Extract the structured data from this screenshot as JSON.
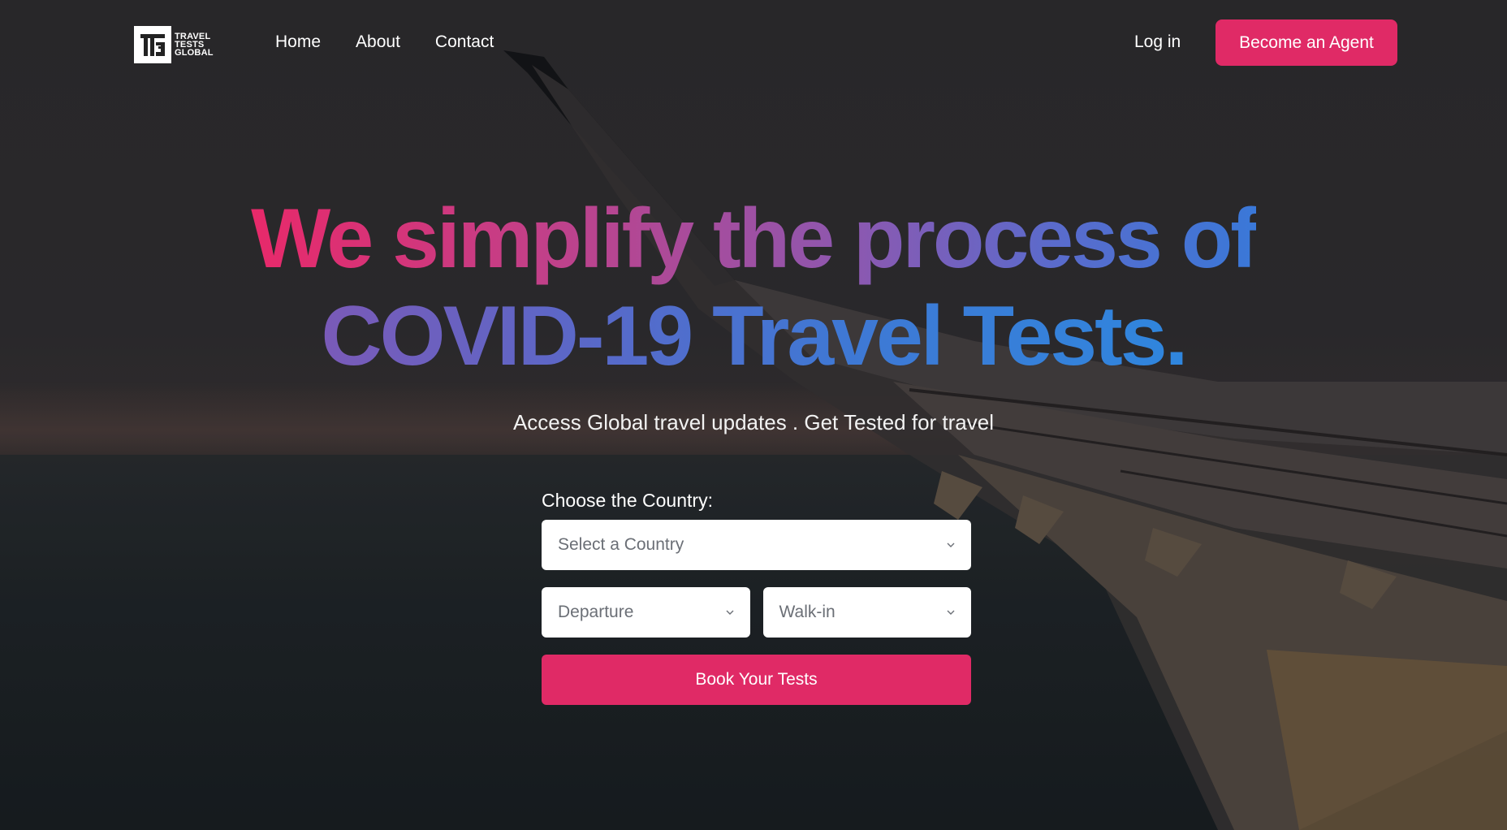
{
  "nav": {
    "logo_lines": [
      "TRAVEL",
      "TESTS",
      "GLOBAL"
    ],
    "links": [
      "Home",
      "About",
      "Contact"
    ],
    "login_label": "Log in",
    "agent_label": "Become an Agent"
  },
  "hero": {
    "headline_line1": "We simplify the process of",
    "headline_line2": "COVID-19 Travel Tests.",
    "subtitle": "Access Global travel updates . Get Tested for travel"
  },
  "form": {
    "label": "Choose the Country:",
    "country_value": "Select a Country",
    "direction_value": "Departure",
    "mode_value": "Walk-in",
    "submit_label": "Book Your Tests"
  },
  "colors": {
    "accent": "#e02a66",
    "gradient_start": "#e8296a",
    "gradient_end": "#2f86de"
  }
}
